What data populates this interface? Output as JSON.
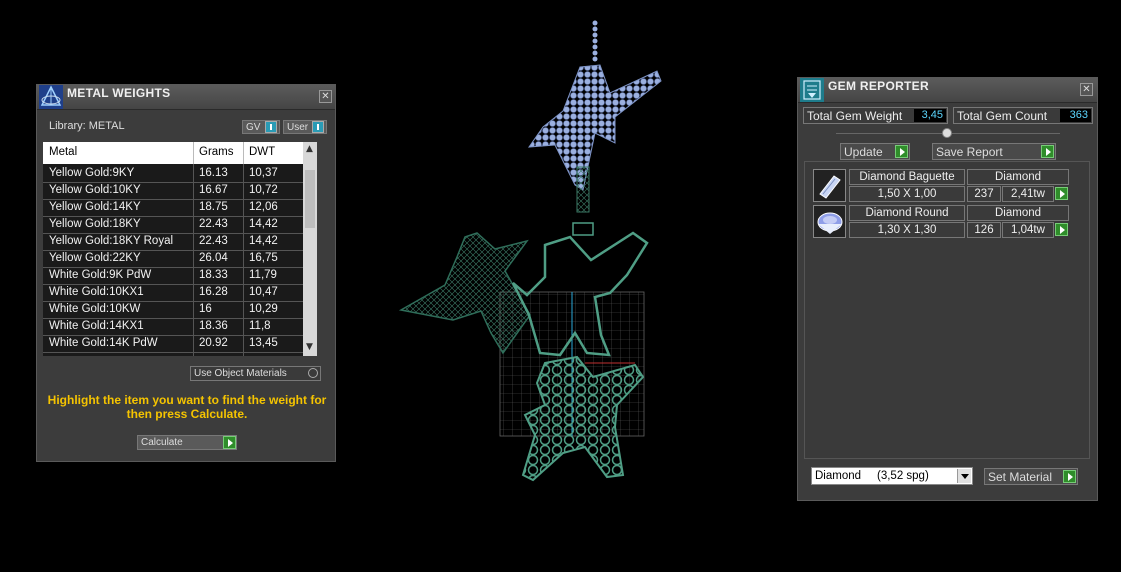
{
  "metal_weights": {
    "title": "METAL WEIGHTS",
    "library_label": "Library: METAL",
    "gv_label": "GV",
    "user_label": "User",
    "columns": [
      "Metal",
      "Grams",
      "DWT"
    ],
    "rows": [
      {
        "metal": "Yellow Gold:9KY",
        "grams": "16.13",
        "dwt": "10,37"
      },
      {
        "metal": "Yellow Gold:10KY",
        "grams": "16.67",
        "dwt": "10,72"
      },
      {
        "metal": "Yellow Gold:14KY",
        "grams": "18.75",
        "dwt": "12,06"
      },
      {
        "metal": "Yellow Gold:18KY",
        "grams": "22.43",
        "dwt": "14,42"
      },
      {
        "metal": "Yellow Gold:18KY Royal",
        "grams": "22.43",
        "dwt": "14,42"
      },
      {
        "metal": "Yellow Gold:22KY",
        "grams": "26.04",
        "dwt": "16,75"
      },
      {
        "metal": "White Gold:9K PdW",
        "grams": "18.33",
        "dwt": "11,79"
      },
      {
        "metal": "White Gold:10KX1",
        "grams": "16.28",
        "dwt": "10,47"
      },
      {
        "metal": "White Gold:10KW",
        "grams": "16",
        "dwt": "10,29"
      },
      {
        "metal": "White Gold:14KX1",
        "grams": "18.36",
        "dwt": "11,8"
      },
      {
        "metal": "White Gold:14K PdW",
        "grams": "20.92",
        "dwt": "13,45"
      }
    ],
    "use_object_materials": "Use Object Materials",
    "instruction": "Highlight the item you want to find the weight for then press Calculate.",
    "calculate_label": "Calculate"
  },
  "gem_reporter": {
    "title": "GEM REPORTER",
    "total_weight_label": "Total Gem Weight",
    "total_weight_value": "3,45",
    "total_count_label": "Total Gem Count",
    "total_count_value": "363",
    "update_label": "Update",
    "save_report_label": "Save Report",
    "gems": [
      {
        "name": "Diamond Baguette",
        "material": "Diamond",
        "size": "1,50 X 1,00",
        "count": "237",
        "weight": "2,41tw",
        "icon": "baguette-gem-icon"
      },
      {
        "name": "Diamond Round",
        "material": "Diamond",
        "size": "1,30 X 1,30",
        "count": "126",
        "weight": "1,04tw",
        "icon": "round-gem-icon"
      }
    ],
    "material_select": "Diamond     (3,52 spg)",
    "set_material_label": "Set Material"
  },
  "colors": {
    "panel": "#3c3c3c",
    "accent_yellow": "#f5c400",
    "value_cyan": "#5cd7ff",
    "go_green": "#2f8d2a",
    "gem_blue": "#8fa8dc",
    "mesh_green": "#2f6e5a"
  }
}
